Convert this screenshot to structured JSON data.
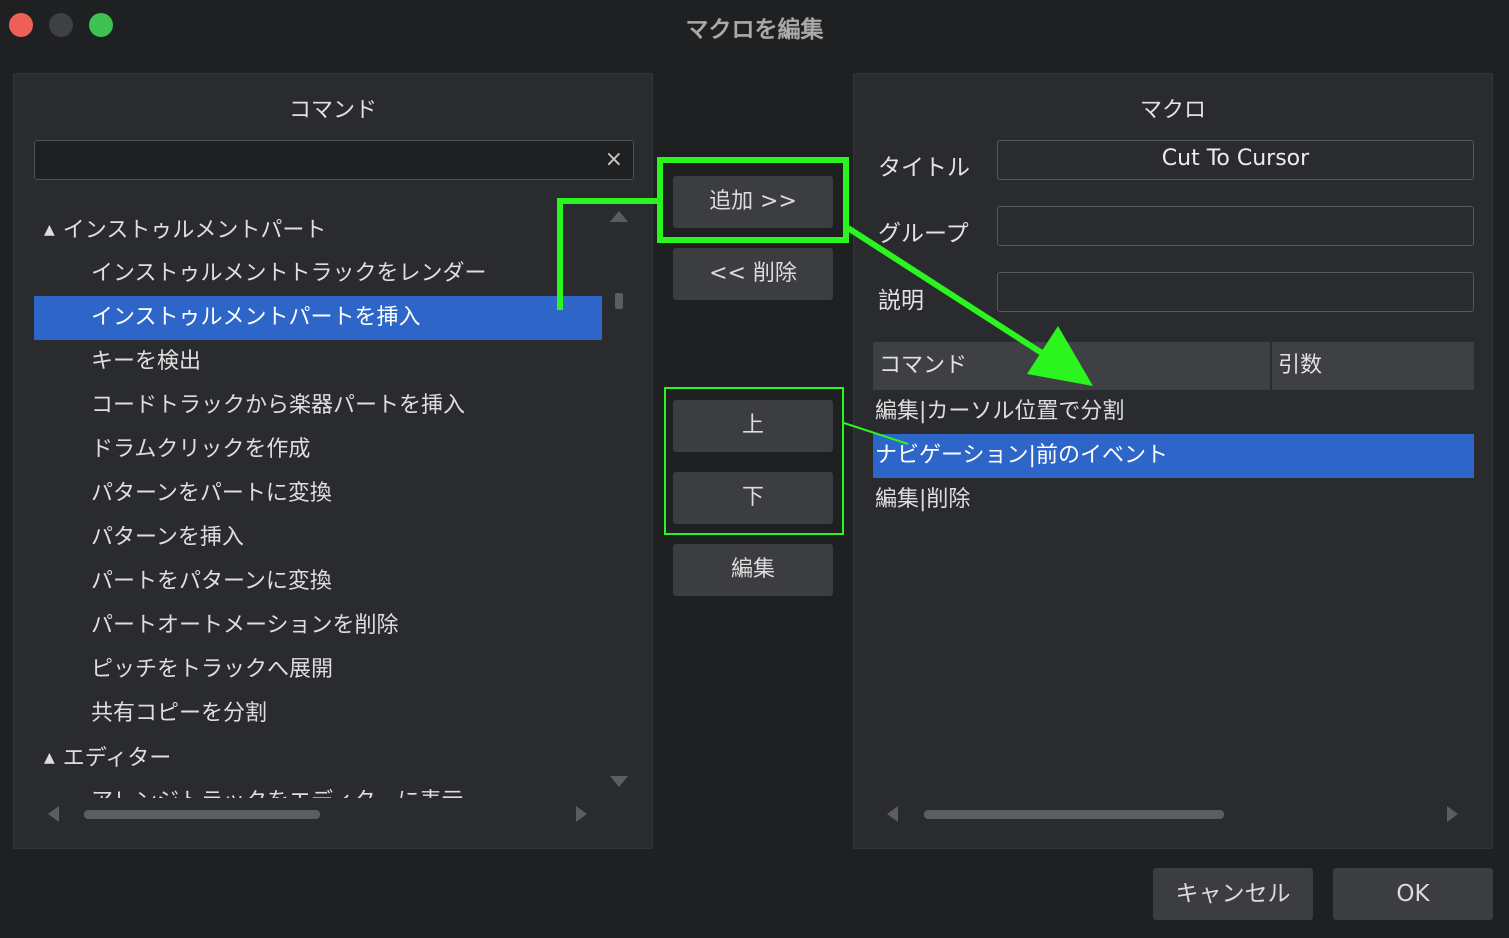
{
  "window": {
    "title": "マクロを編集"
  },
  "colors": {
    "accent": "#2d66c8",
    "highlight": "#2af51f",
    "close": "#ee5f58",
    "maximize": "#3fc24f"
  },
  "commands_panel": {
    "title": "コマンド",
    "search": {
      "value": "",
      "placeholder": "",
      "clear_icon": "×"
    },
    "tree": [
      {
        "type": "group",
        "label": "インストゥルメントパート",
        "expanded": true
      },
      {
        "type": "child",
        "label": "インストゥルメントトラックをレンダー"
      },
      {
        "type": "child",
        "label": "インストゥルメントパートを挿入",
        "selected": true
      },
      {
        "type": "child",
        "label": "キーを検出"
      },
      {
        "type": "child",
        "label": "コードトラックから楽器パートを挿入"
      },
      {
        "type": "child",
        "label": "ドラムクリックを作成"
      },
      {
        "type": "child",
        "label": "パターンをパートに変換"
      },
      {
        "type": "child",
        "label": "パターンを挿入"
      },
      {
        "type": "child",
        "label": "パートをパターンに変換"
      },
      {
        "type": "child",
        "label": "パートオートメーションを削除"
      },
      {
        "type": "child",
        "label": "ピッチをトラックへ展開"
      },
      {
        "type": "child",
        "label": "共有コピーを分割"
      },
      {
        "type": "group",
        "label": "エディター",
        "expanded": true
      },
      {
        "type": "child",
        "label": "アレンジトラックをエディターに表示"
      }
    ]
  },
  "middle_buttons": {
    "add": "追加 >>",
    "remove": "<< 削除",
    "up": "上",
    "down": "下",
    "edit": "編集"
  },
  "macro_panel": {
    "title": "マクロ",
    "title_label": "タイトル",
    "title_value": "Cut To Cursor",
    "group_label": "グループ",
    "group_value": "",
    "description_label": "説明",
    "description_value": "",
    "columns": [
      "コマンド",
      "引数"
    ],
    "rows": [
      {
        "label": "編集|カーソル位置で分割"
      },
      {
        "label": "ナビゲーション|前のイベント",
        "selected": true
      },
      {
        "label": "編集|削除"
      }
    ]
  },
  "footer": {
    "cancel": "キャンセル",
    "ok": "OK"
  }
}
